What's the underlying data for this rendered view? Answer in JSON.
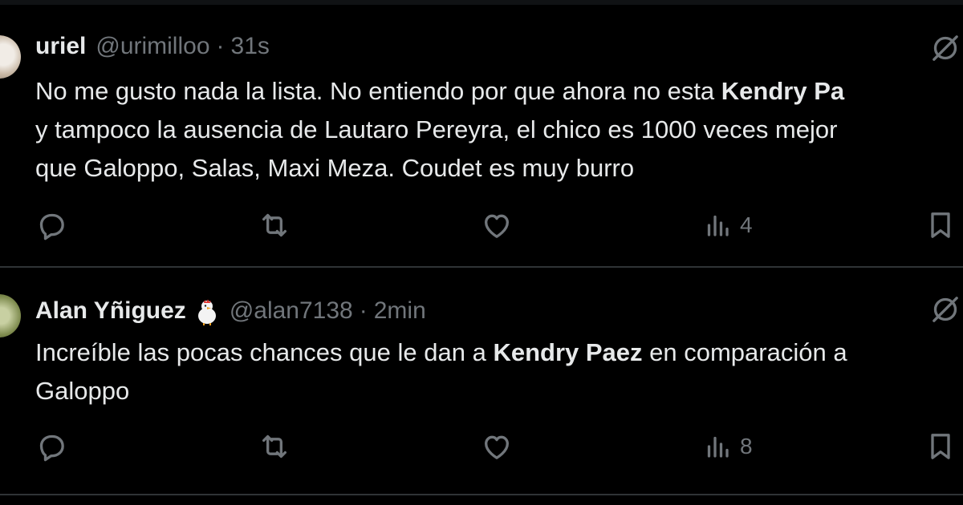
{
  "tweets": [
    {
      "display_name": "uriel",
      "handle": "@urimilloo",
      "separator": "·",
      "time": "31s",
      "lines": [
        {
          "parts": [
            {
              "text": "No me gusto nada la lista. No entiendo por que ahora no esta ",
              "bold": false
            },
            {
              "text": "Kendry Pa",
              "bold": true
            }
          ]
        },
        {
          "parts": [
            {
              "text": "y tampoco la ausencia de Lautaro Pereyra, el chico es 1000 veces mejor",
              "bold": false
            }
          ]
        },
        {
          "parts": [
            {
              "text": "que Galoppo, Salas, Maxi Meza. Coudet es muy burro",
              "bold": false
            }
          ]
        }
      ],
      "views": "4",
      "has_badge": false
    },
    {
      "display_name": "Alan Yñiguez",
      "handle": "@alan7138",
      "separator": "·",
      "time": "2min",
      "lines": [
        {
          "parts": [
            {
              "text": "Increíble las pocas chances que le dan a ",
              "bold": false
            },
            {
              "text": "Kendry Paez",
              "bold": true
            },
            {
              "text": " en comparación a",
              "bold": false
            }
          ]
        },
        {
          "parts": [
            {
              "text": "Galoppo",
              "bold": false
            }
          ]
        }
      ],
      "views": "8",
      "has_badge": true
    }
  ],
  "icons": {
    "reply": "reply-icon",
    "retweet": "retweet-icon",
    "like": "heart-icon",
    "views": "views-icon",
    "bookmark": "bookmark-icon",
    "more": "grok-icon",
    "badge": "chicken-emoji-icon"
  },
  "colors": {
    "background": "#000000",
    "text": "#e7e9ea",
    "muted": "#71767b",
    "divider": "#2f3336"
  }
}
